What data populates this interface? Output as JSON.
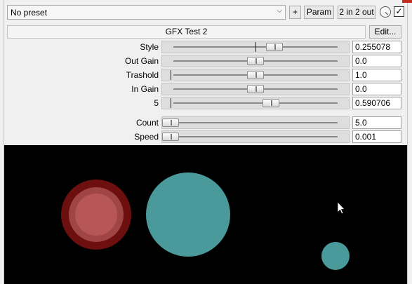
{
  "toolbar": {
    "preset_value": "No preset",
    "plus_label": "+",
    "param_label": "Param",
    "io_label": "2 in 2 out",
    "check_mark": "✓"
  },
  "effect": {
    "title": "GFX Test 2",
    "edit_label": "Edit..."
  },
  "params": [
    {
      "label": "Style",
      "value": "0.255078",
      "position": 0.61,
      "mark": 0.5
    },
    {
      "label": "Out Gain",
      "value": "0.0",
      "position": 0.5
    },
    {
      "label": "Trashold",
      "value": "1.0",
      "position": 0.5,
      "mark": 0.0
    },
    {
      "label": "In Gain",
      "value": "0.0",
      "position": 0.5
    },
    {
      "label": "5",
      "value": "0.590706",
      "position": 0.59,
      "mark": 0.0
    },
    {
      "label": "Count",
      "value": "5.0",
      "position": 0.0
    },
    {
      "label": "Speed",
      "value": "0.001",
      "position": 0.0
    }
  ],
  "canvas": {
    "background": "#000000",
    "circle_colors": {
      "teal": "#4a9a9c",
      "red_outer": "#6e0f0f",
      "red_mid": "#a04545",
      "red_inner": "#b65656"
    }
  },
  "icons": {
    "dropdown": "chevron-down-icon",
    "knob": "wet-knob-icon",
    "bypass": "checkbox-icon",
    "cursor": "mouse-cursor-icon"
  }
}
